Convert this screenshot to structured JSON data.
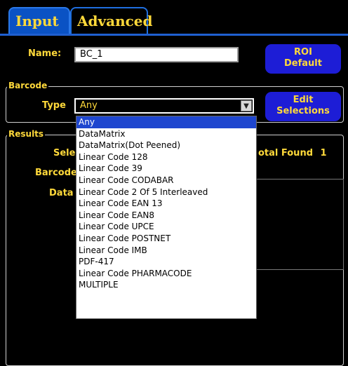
{
  "tabs": [
    {
      "label": "Input"
    },
    {
      "label": "Advanced"
    }
  ],
  "form": {
    "name_label": "Name:",
    "name_value": "BC_1",
    "roi_button_label": "ROI Default",
    "barcode_group_title": "Barcode",
    "type_label": "Type",
    "type_value": "Any",
    "edit_button_label": "Edit Selections"
  },
  "results": {
    "group_title": "Results",
    "selected_label_partial": "Sele",
    "barcode_label_partial": "Barcode",
    "data_label_partial": "Data",
    "total_found_label": "otal Found",
    "total_found_value": "1"
  },
  "dropdown": {
    "selected_index": 0,
    "options": [
      "Any",
      "DataMatrix",
      "DataMatrix(Dot Peened)",
      "Linear Code 128",
      "Linear Code 39",
      "Linear Code CODABAR",
      "Linear Code 2 Of 5 Interleaved",
      "Linear Code EAN 13",
      "Linear Code EAN8",
      "Linear Code UPCE",
      "Linear Code POSTNET",
      "Linear Code IMB",
      "PDF-417",
      "Linear Code PHARMACODE",
      "MULTIPLE"
    ]
  },
  "colors": {
    "label_yellow": "#ffd93a",
    "button_blue": "#1d1dd6",
    "active_tab_blue": "#0a52c4",
    "selection_blue": "#1e46cf"
  },
  "icons": {
    "select_arrow": "chevron-down-icon"
  }
}
